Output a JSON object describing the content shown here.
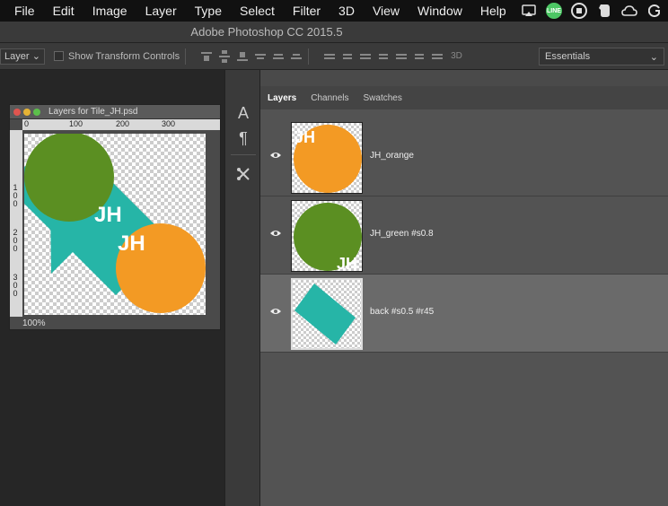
{
  "menubar": {
    "items": [
      "File",
      "Edit",
      "Image",
      "Layer",
      "Type",
      "Select",
      "Filter",
      "3D",
      "View",
      "Window",
      "Help"
    ],
    "tray_icons": [
      "cast-icon",
      "line-icon",
      "stop-icon",
      "evernote-icon",
      "creative-cloud-icon",
      "g-icon"
    ],
    "line_label": "LINE"
  },
  "window": {
    "title": "Adobe Photoshop CC 2015.5"
  },
  "options": {
    "auto_select_value": "Layer",
    "show_transform_label": "Show Transform Controls",
    "mode_3d_label": "3D",
    "workspace": "Essentials"
  },
  "document": {
    "title": "Layers for Tile_JH.psd",
    "ruler_h": [
      "0",
      "100",
      "200",
      "300"
    ],
    "ruler_v": [
      "100",
      "200",
      "300"
    ],
    "zoom": "100%",
    "monogram": "JH"
  },
  "panel": {
    "tabs": [
      "Layers",
      "Channels",
      "Swatches"
    ],
    "layers": [
      {
        "name": "JH_orange",
        "selected": false
      },
      {
        "name": "JH_green #s0.8",
        "selected": false
      },
      {
        "name": "back #s0.5 #r45",
        "selected": true
      }
    ]
  },
  "colors": {
    "orange": "#f39a24",
    "green": "#5b8f22",
    "teal": "#26b5a7"
  }
}
